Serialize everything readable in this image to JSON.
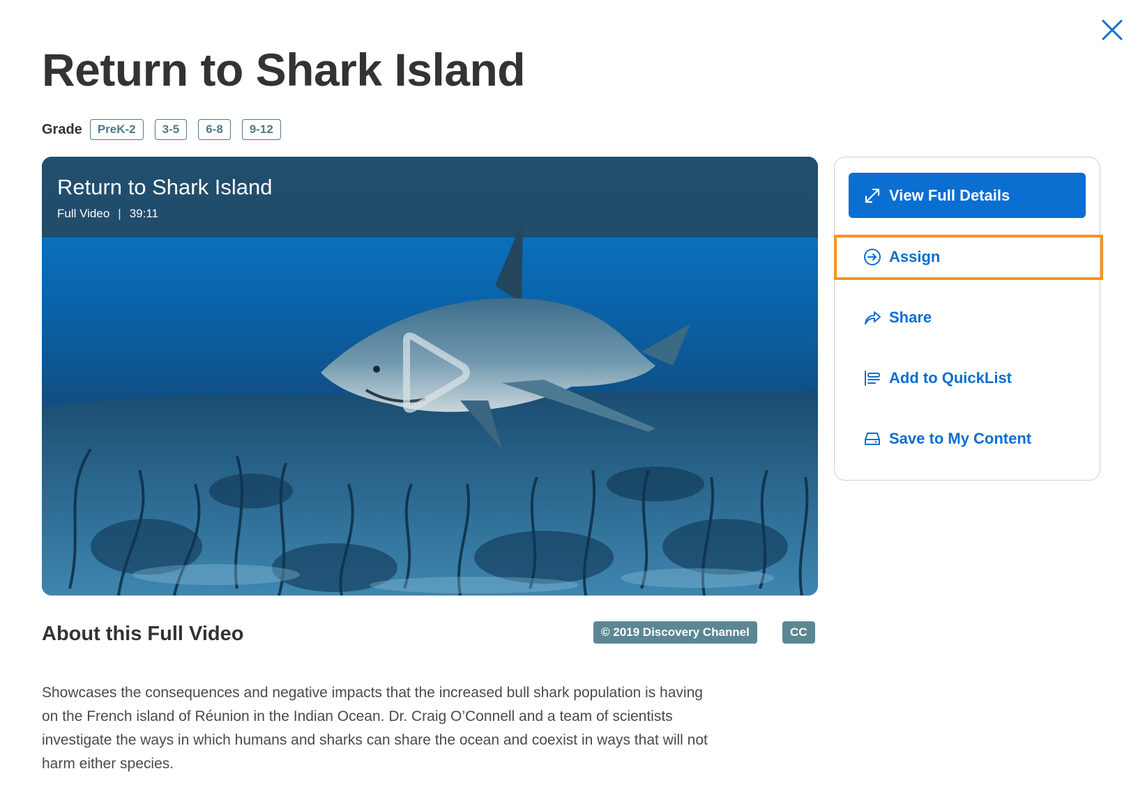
{
  "page": {
    "title": "Return to Shark Island",
    "close_icon": "close-icon"
  },
  "grades": {
    "label": "Grade",
    "chips": [
      "PreK-2",
      "3-5",
      "6-8",
      "9-12"
    ]
  },
  "video": {
    "title": "Return to Shark Island",
    "type": "Full Video",
    "separator": "|",
    "duration": "39:11",
    "play_icon": "play-icon"
  },
  "about": {
    "title": "About this Full Video",
    "copyright": "© 2019 Discovery Channel",
    "cc": "CC",
    "description": "Showcases the consequences and negative impacts that the increased bull shark population is having on the French island of Réunion in the Indian Ocean. Dr. Craig O’Connell and a team of scientists investigate the ways in which humans and sharks can share the ocean and coexist in ways that will not harm either species."
  },
  "actions": {
    "view_full_details": "View Full Details",
    "assign": "Assign",
    "share": "Share",
    "add_to_quicklist": "Add to QuickList",
    "save_to_my_content": "Save to My Content"
  },
  "colors": {
    "accent": "#0b6ed1",
    "highlight": "#f7941d",
    "chip": "#4e7a88",
    "badge": "#5b8794"
  }
}
